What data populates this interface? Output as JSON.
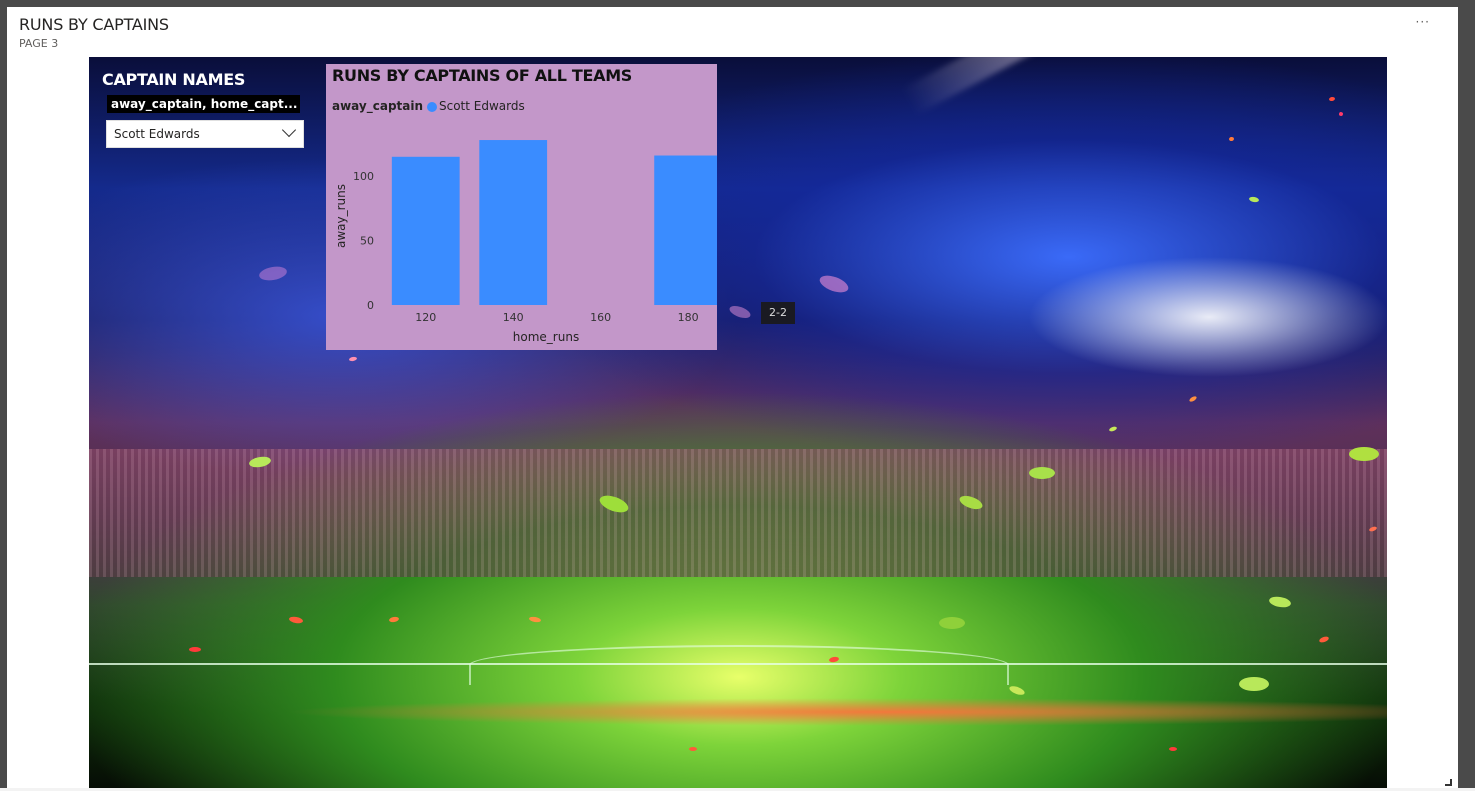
{
  "page": {
    "title": "RUNS BY CAPTAINS",
    "subtitle": "PAGE 3",
    "more_label": "···"
  },
  "background": {
    "scoreboard_text": "2-2"
  },
  "slicer": {
    "title": "CAPTAIN NAMES",
    "field_label": "away_captain, home_capt...",
    "selected_value": "Scott Edwards"
  },
  "chart_data": {
    "type": "bar",
    "title": "RUNS BY CAPTAINS OF ALL TEAMS",
    "legend_title": "away_captain",
    "xlabel": "home_runs",
    "ylabel": "away_runs",
    "x_ticks": [
      120,
      140,
      160,
      180
    ],
    "y_ticks": [
      0,
      50,
      100
    ],
    "xlim": [
      110,
      185
    ],
    "ylim": [
      0,
      142
    ],
    "series": [
      {
        "name": "Scott Edwards",
        "color": "#3a8cff",
        "bars": [
          {
            "x": 120,
            "y": 115
          },
          {
            "x": 140,
            "y": 128
          },
          {
            "x": 180,
            "y": 116
          }
        ]
      }
    ],
    "bar_width": 15.5,
    "grid": false,
    "legend_position": "top-left"
  }
}
